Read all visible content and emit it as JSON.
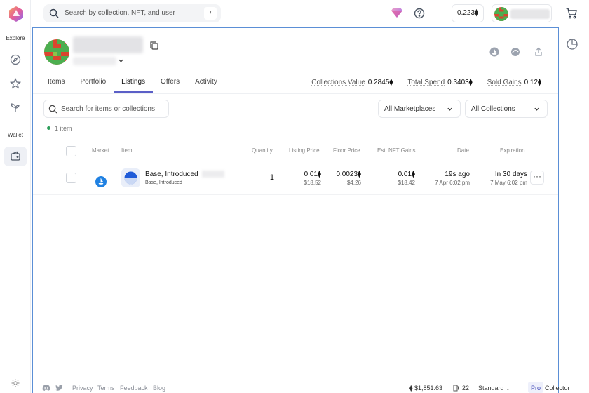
{
  "rail": {
    "explore_label": "Explore",
    "wallet_label": "Wallet"
  },
  "topbar": {
    "search_placeholder": "Search by collection, NFT, and user",
    "search_shortcut": "/",
    "balance": "0.223⧫"
  },
  "tabs": [
    {
      "label": "Items",
      "active": false
    },
    {
      "label": "Portfolio",
      "active": false
    },
    {
      "label": "Listings",
      "active": true
    },
    {
      "label": "Offers",
      "active": false
    },
    {
      "label": "Activity",
      "active": false
    }
  ],
  "stats": {
    "collections_value_label": "Collections Value",
    "collections_value": "0.2845⧫",
    "total_spend_label": "Total Spend",
    "total_spend": "0.3403⧫",
    "sold_gains_label": "Sold Gains",
    "sold_gains": "0.12⧫"
  },
  "filters": {
    "search_placeholder": "Search for items or collections",
    "marketplaces": "All Marketplaces",
    "collections": "All Collections"
  },
  "count_text": "1 item",
  "table": {
    "headers": {
      "market": "Market",
      "item": "Item",
      "quantity": "Quantity",
      "listing_price": "Listing Price",
      "floor_price": "Floor Price",
      "gains": "Est. NFT Gains",
      "date": "Date",
      "expiration": "Expiration"
    },
    "rows": [
      {
        "item_name": "Base, Introduced",
        "item_collection": "Base, Introduced",
        "quantity": "1",
        "listing_price": "0.01⧫",
        "listing_usd": "$18.52",
        "floor_price": "0.0023⧫",
        "floor_usd": "$4.26",
        "gains": "0.01⧫",
        "gains_usd": "$18.42",
        "date": "19s ago",
        "date_full": "7 Apr 6:02 pm",
        "expiration": "In 30 days",
        "expiration_full": "7 May 6:02 pm"
      }
    ]
  },
  "footer": {
    "privacy": "Privacy",
    "terms": "Terms",
    "feedback": "Feedback",
    "blog": "Blog",
    "eth_price": "⧫ $1,851.63",
    "gas": "22",
    "mode": "Standard",
    "pro": "Pro",
    "collector": "Collector"
  },
  "colors": {
    "accent": "#5b5fc7",
    "panel_border": "#5b8fd6",
    "status_dot": "#2e9e5b"
  },
  "icons": [
    "search-icon",
    "gem-icon",
    "help-icon",
    "cart-icon",
    "compass-icon",
    "star-icon",
    "sprout-icon",
    "wallet-icon",
    "sun-icon",
    "copy-icon",
    "opensea-icon",
    "blur-icon",
    "share-icon",
    "pie-chart-icon",
    "chevron-down-icon",
    "more-icon",
    "discord-icon",
    "twitter-icon",
    "gas-icon"
  ]
}
